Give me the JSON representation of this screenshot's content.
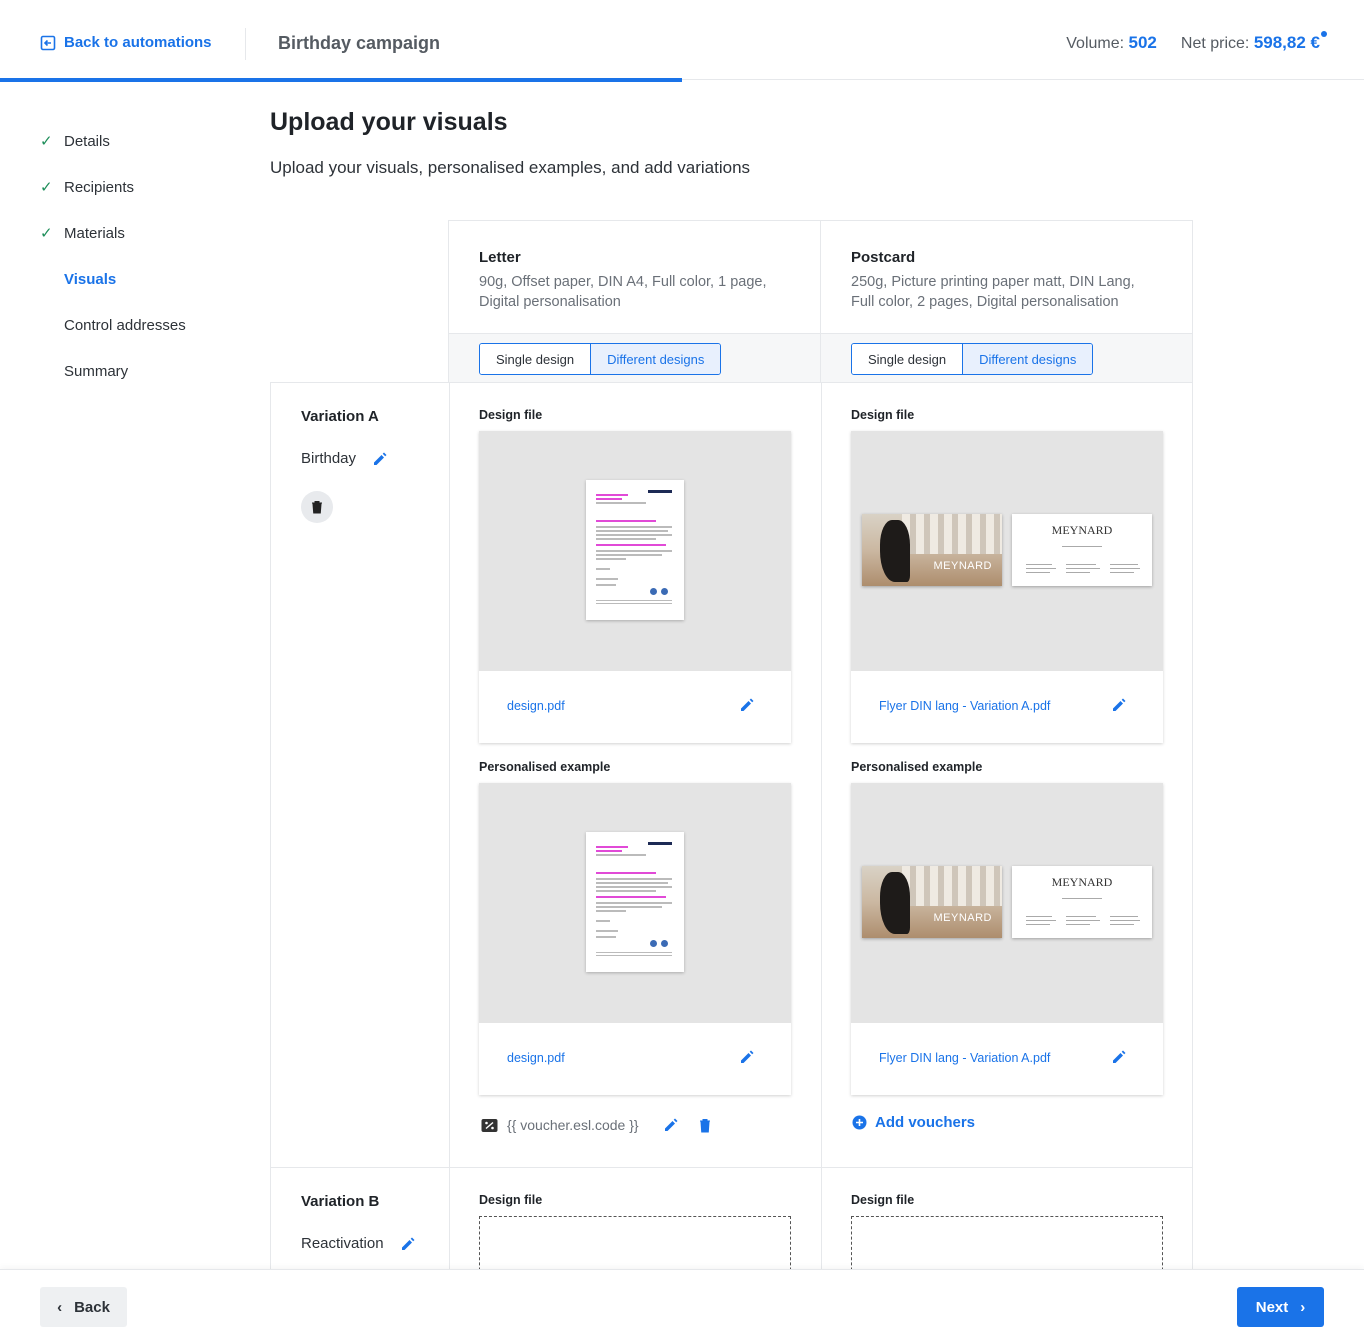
{
  "header": {
    "back_label": "Back to automations",
    "campaign_title": "Birthday campaign",
    "volume_label": "Volume:",
    "volume_value": "502",
    "price_label": "Net price:",
    "price_value": "598,82 €"
  },
  "progress_fraction": 0.5,
  "sidebar": {
    "steps": [
      {
        "label": "Details",
        "done": true
      },
      {
        "label": "Recipients",
        "done": true
      },
      {
        "label": "Materials",
        "done": true
      },
      {
        "label": "Visuals",
        "active": true
      },
      {
        "label": "Control addresses"
      },
      {
        "label": "Summary"
      }
    ]
  },
  "main": {
    "title": "Upload your visuals",
    "subtitle": "Upload your visuals, personalised examples, and add variations"
  },
  "products": [
    {
      "name": "Letter",
      "description": "90g, Offset paper, DIN A4, Full color, 1 page, Digital personalisation",
      "toggle": {
        "single": "Single design",
        "different": "Different designs",
        "selected": "different"
      }
    },
    {
      "name": "Postcard",
      "description": "250g, Picture printing paper matt, DIN Lang, Full color, 2 pages, Digital personalisation",
      "toggle": {
        "single": "Single design",
        "different": "Different designs",
        "selected": "different"
      }
    }
  ],
  "variations": [
    {
      "label": "Variation A",
      "name": "Birthday",
      "letter": {
        "design_label": "Design file",
        "design_file": "design.pdf",
        "example_label": "Personalised example",
        "example_file": "design.pdf",
        "voucher_code": "{{ voucher.esl.code }}"
      },
      "postcard": {
        "design_label": "Design file",
        "design_file": "Flyer DIN lang - Variation A.pdf",
        "example_label": "Personalised example",
        "example_file": "Flyer DIN lang - Variation A.pdf",
        "add_vouchers": "Add vouchers",
        "brand": "MEYNARD"
      }
    },
    {
      "label": "Variation B",
      "name": "Reactivation",
      "letter": {
        "design_label": "Design file"
      },
      "postcard": {
        "design_label": "Design file"
      }
    }
  ],
  "footer": {
    "back_label": "Back",
    "next_label": "Next"
  },
  "colors": {
    "accent": "#1a73e8",
    "check": "#1e8e5a"
  }
}
